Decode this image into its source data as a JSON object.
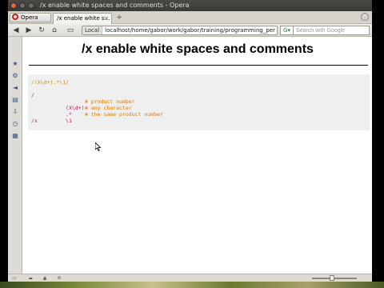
{
  "window": {
    "title": "/x enable white spaces and comments - Opera"
  },
  "tabs": {
    "menu_label": "Opera",
    "active_tab": "/x enable white s...",
    "close_glyph": "×",
    "new_tab_glyph": "+"
  },
  "nav": {
    "back_glyph": "◀",
    "forward_glyph": "▶",
    "reload_glyph": "↻",
    "home_glyph": "⌂",
    "address_badge": "Local",
    "address_url": "localhost/home/gabor/work/gabor/training/programming_per",
    "search_engine_glyph": "G▾",
    "search_placeholder": "Search with Google"
  },
  "sidepanel": {
    "icons": [
      "bookmarks-icon",
      "settings-icon",
      "share-icon",
      "notes-icon",
      "transfers-icon",
      "history-icon",
      "panel-icon"
    ],
    "glyphs": [
      "★",
      "⚙",
      "◄",
      "▤",
      "⇩",
      "◷",
      "▦"
    ]
  },
  "page": {
    "title": "/x enable white spaces and comments",
    "code": {
      "line1": "/(X\\d+).*\\1/",
      "line2": "/",
      "line3": " (X\\d+)",
      "line3_comment": "# product number",
      "line4": " .*",
      "line4_comment": "# any character",
      "line5": " \\1",
      "line5_comment": "# the same product number",
      "line6": "/x"
    }
  },
  "status": {
    "glyphs": [
      "▭",
      "☁",
      "▲",
      "⊘"
    ]
  },
  "colors": {
    "code_orange": "#d88a00",
    "code_magenta": "#c2185b",
    "code_background": "#efefef"
  }
}
